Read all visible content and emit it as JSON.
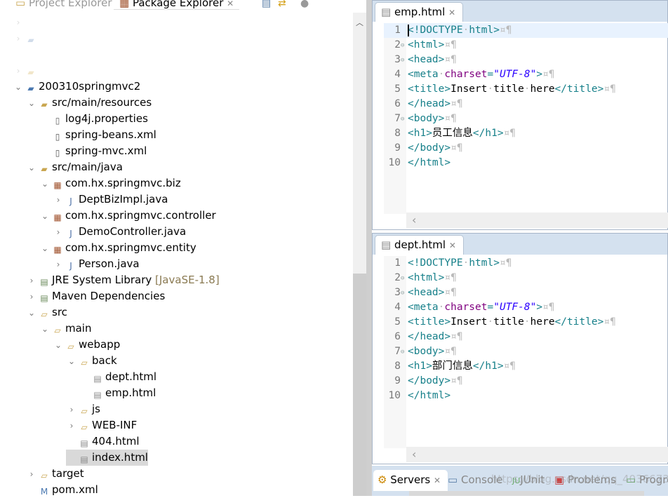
{
  "left_panel": {
    "tabs": [
      {
        "label": "Project Explorer",
        "active": false
      },
      {
        "label": "Package Explorer",
        "active": true
      }
    ],
    "tree": [
      {
        "label": "",
        "level": 0,
        "chevron": "right",
        "icon": "none",
        "blurred": true
      },
      {
        "label": "",
        "level": 0,
        "chevron": "right",
        "icon": "maven-project-icon",
        "blurred": true
      },
      {
        "label": "",
        "level": 0,
        "chevron": "none",
        "icon": "none",
        "blurred": true
      },
      {
        "label": "",
        "level": 0,
        "chevron": "right",
        "icon": "maven-project-warning-icon",
        "blurred": true
      },
      {
        "label": "200310springmvc2",
        "level": 0,
        "chevron": "down",
        "icon": "maven-project-icon"
      },
      {
        "label": "src/main/resources",
        "level": 1,
        "chevron": "down",
        "icon": "source-folder-icon"
      },
      {
        "label": "log4j.properties",
        "level": 2,
        "chevron": "none",
        "icon": "file-icon"
      },
      {
        "label": "spring-beans.xml",
        "level": 2,
        "chevron": "none",
        "icon": "xml-file-icon"
      },
      {
        "label": "spring-mvc.xml",
        "level": 2,
        "chevron": "none",
        "icon": "xml-file-icon"
      },
      {
        "label": "src/main/java",
        "level": 1,
        "chevron": "down",
        "icon": "source-folder-icon"
      },
      {
        "label": "com.hx.springmvc.biz",
        "level": 2,
        "chevron": "down",
        "icon": "package-icon"
      },
      {
        "label": "DeptBizImpl.java",
        "level": 3,
        "chevron": "right",
        "icon": "java-file-icon"
      },
      {
        "label": "com.hx.springmvc.controller",
        "level": 2,
        "chevron": "down",
        "icon": "package-icon"
      },
      {
        "label": "DemoController.java",
        "level": 3,
        "chevron": "right",
        "icon": "java-file-icon"
      },
      {
        "label": "com.hx.springmvc.entity",
        "level": 2,
        "chevron": "down",
        "icon": "package-icon"
      },
      {
        "label": "Person.java",
        "level": 3,
        "chevron": "right",
        "icon": "java-file-icon"
      },
      {
        "label": "JRE System Library",
        "suffix": "[JavaSE-1.8]",
        "level": 1,
        "chevron": "right",
        "icon": "library-icon"
      },
      {
        "label": "Maven Dependencies",
        "level": 1,
        "chevron": "right",
        "icon": "library-icon"
      },
      {
        "label": "src",
        "level": 1,
        "chevron": "down",
        "icon": "folder-icon"
      },
      {
        "label": "main",
        "level": 2,
        "chevron": "down",
        "icon": "folder-icon"
      },
      {
        "label": "webapp",
        "level": 3,
        "chevron": "down",
        "icon": "folder-icon"
      },
      {
        "label": "back",
        "level": 4,
        "chevron": "down",
        "icon": "folder-icon"
      },
      {
        "label": "dept.html",
        "level": 5,
        "chevron": "none",
        "icon": "html-file-icon"
      },
      {
        "label": "emp.html",
        "level": 5,
        "chevron": "none",
        "icon": "html-file-icon"
      },
      {
        "label": "js",
        "level": 4,
        "chevron": "right",
        "icon": "folder-icon"
      },
      {
        "label": "WEB-INF",
        "level": 4,
        "chevron": "right",
        "icon": "folder-icon"
      },
      {
        "label": "404.html",
        "level": 4,
        "chevron": "none",
        "icon": "html-file-icon"
      },
      {
        "label": "index.html",
        "level": 4,
        "chevron": "none",
        "icon": "html-file-icon",
        "selected": true
      },
      {
        "label": "target",
        "level": 1,
        "chevron": "right",
        "icon": "folder-icon"
      },
      {
        "label": "pom.xml",
        "level": 1,
        "chevron": "none",
        "icon": "maven-pom-icon"
      }
    ]
  },
  "editors": [
    {
      "tab": "emp.html",
      "lines": [
        [
          [
            "tag",
            "<!DOCTYPE"
          ],
          [
            "ws",
            "·"
          ],
          [
            "tag",
            "html>"
          ],
          [
            "ws",
            "¤¶"
          ]
        ],
        [
          [
            "tag",
            "<html>"
          ],
          [
            "ws",
            "¤¶"
          ]
        ],
        [
          [
            "tag",
            "<head>"
          ],
          [
            "ws",
            "¤¶"
          ]
        ],
        [
          [
            "tag",
            "<meta"
          ],
          [
            "ws",
            "·"
          ],
          [
            "attr",
            "charset"
          ],
          [
            "tag",
            "="
          ],
          [
            "str",
            "\"UTF-8\""
          ],
          [
            "tag",
            ">"
          ],
          [
            "ws",
            "¤¶"
          ]
        ],
        [
          [
            "tag",
            "<title>"
          ],
          [
            "txt",
            "Insert"
          ],
          [
            "ws",
            "·"
          ],
          [
            "txt",
            "title"
          ],
          [
            "ws",
            "·"
          ],
          [
            "txt",
            "here"
          ],
          [
            "tag",
            "</title>"
          ],
          [
            "ws",
            "¤¶"
          ]
        ],
        [
          [
            "tag",
            "</head>"
          ],
          [
            "ws",
            "¤¶"
          ]
        ],
        [
          [
            "tag",
            "<body>"
          ],
          [
            "ws",
            "¤¶"
          ]
        ],
        [
          [
            "tag",
            "<h1>"
          ],
          [
            "txt",
            "员工信息"
          ],
          [
            "tag",
            "</h1>"
          ],
          [
            "ws",
            "¤¶"
          ]
        ],
        [
          [
            "tag",
            "</body>"
          ],
          [
            "ws",
            "¤¶"
          ]
        ],
        [
          [
            "tag",
            "</html>"
          ]
        ]
      ]
    },
    {
      "tab": "dept.html",
      "lines": [
        [
          [
            "tag",
            "<!DOCTYPE"
          ],
          [
            "ws",
            "·"
          ],
          [
            "tag",
            "html>"
          ],
          [
            "ws",
            "¤¶"
          ]
        ],
        [
          [
            "tag",
            "<html>"
          ],
          [
            "ws",
            "¤¶"
          ]
        ],
        [
          [
            "tag",
            "<head>"
          ],
          [
            "ws",
            "¤¶"
          ]
        ],
        [
          [
            "tag",
            "<meta"
          ],
          [
            "ws",
            "·"
          ],
          [
            "attr",
            "charset"
          ],
          [
            "tag",
            "="
          ],
          [
            "str",
            "\"UTF-8\""
          ],
          [
            "tag",
            ">"
          ],
          [
            "ws",
            "¤¶"
          ]
        ],
        [
          [
            "tag",
            "<title>"
          ],
          [
            "txt",
            "Insert"
          ],
          [
            "ws",
            "·"
          ],
          [
            "txt",
            "title"
          ],
          [
            "ws",
            "·"
          ],
          [
            "txt",
            "here"
          ],
          [
            "tag",
            "</title>"
          ],
          [
            "ws",
            "¤¶"
          ]
        ],
        [
          [
            "tag",
            "</head>"
          ],
          [
            "ws",
            "¤¶"
          ]
        ],
        [
          [
            "tag",
            "<body>"
          ],
          [
            "ws",
            "¤¶"
          ]
        ],
        [
          [
            "tag",
            "<h1>"
          ],
          [
            "txt",
            "部门信息"
          ],
          [
            "tag",
            "</h1>"
          ],
          [
            "ws",
            "¤¶"
          ]
        ],
        [
          [
            "tag",
            "</body>"
          ],
          [
            "ws",
            "¤¶"
          ]
        ],
        [
          [
            "tag",
            "</html>"
          ]
        ]
      ]
    }
  ],
  "fold_lines": [
    2,
    3,
    7
  ],
  "bottom_panel": {
    "tabs": [
      {
        "label": "Servers",
        "icon": "servers-icon",
        "active": true
      },
      {
        "label": "Console",
        "icon": "console-icon"
      },
      {
        "label": "JUnit",
        "icon": "junit-icon"
      },
      {
        "label": "Problems",
        "icon": "problems-icon"
      },
      {
        "label": "Progre",
        "icon": "progress-icon"
      }
    ]
  },
  "watermark": "https://blog.csdn.net/qq_40366739"
}
